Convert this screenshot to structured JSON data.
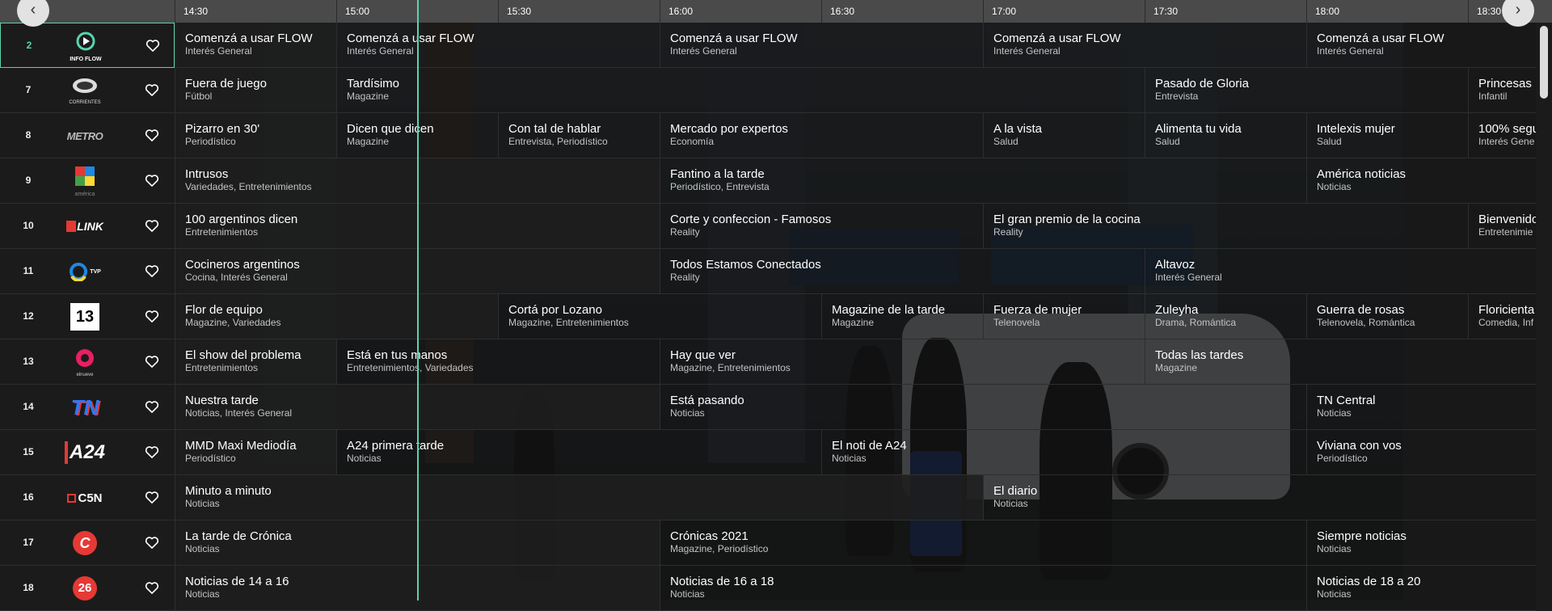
{
  "header": {
    "times": [
      "14:30",
      "15:00",
      "15:30",
      "16:00",
      "16:30",
      "17:00",
      "17:30",
      "18:00",
      "18:30"
    ],
    "prev_label": "‹",
    "next_label": "›"
  },
  "channels": [
    {
      "number": "2",
      "logo": "infoflow",
      "logo_text": "INFO FLOW"
    },
    {
      "number": "7",
      "logo": "corrientes",
      "logo_text": "CORRIENTES"
    },
    {
      "number": "8",
      "logo": "metro",
      "logo_text": "METRO"
    },
    {
      "number": "9",
      "logo": "america",
      "logo_text": "américa"
    },
    {
      "number": "10",
      "logo": "link",
      "logo_text": "LINK"
    },
    {
      "number": "11",
      "logo": "tvp",
      "logo_text": "TVP"
    },
    {
      "number": "12",
      "logo": "eltrece",
      "logo_text": "13"
    },
    {
      "number": "13",
      "logo": "elnueve",
      "logo_text": "elnueve"
    },
    {
      "number": "14",
      "logo": "tn",
      "logo_text": "TN"
    },
    {
      "number": "15",
      "logo": "a24",
      "logo_text": "A24"
    },
    {
      "number": "16",
      "logo": "c5n",
      "logo_text": "C5N"
    },
    {
      "number": "17",
      "logo": "cronica",
      "logo_text": "C"
    },
    {
      "number": "18",
      "logo": "canal26",
      "logo_text": "26"
    }
  ],
  "rows": [
    [
      {
        "s": 0,
        "e": 1,
        "t": "Comenzá a usar FLOW",
        "g": "Interés General"
      },
      {
        "s": 1,
        "e": 3,
        "t": "Comenzá a usar FLOW",
        "g": "Interés General"
      },
      {
        "s": 3,
        "e": 5,
        "t": "Comenzá a usar FLOW",
        "g": "Interés General"
      },
      {
        "s": 5,
        "e": 7,
        "t": "Comenzá a usar FLOW",
        "g": "Interés General"
      },
      {
        "s": 7,
        "e": 9.5,
        "t": "Comenzá a usar FLOW",
        "g": "Interés General"
      }
    ],
    [
      {
        "s": 0,
        "e": 1,
        "t": "Fuera de juego",
        "g": "Fútbol"
      },
      {
        "s": 1,
        "e": 6,
        "t": "Tardísimo",
        "g": "Magazine"
      },
      {
        "s": 6,
        "e": 8,
        "t": "Pasado de Gloria",
        "g": "Entrevista"
      },
      {
        "s": 8,
        "e": 9.5,
        "t": "Princesas",
        "g": "Infantil"
      }
    ],
    [
      {
        "s": 0,
        "e": 1,
        "t": "Pizarro en 30'",
        "g": "Periodístico"
      },
      {
        "s": 1,
        "e": 2,
        "t": "Dicen que dicen",
        "g": "Magazine"
      },
      {
        "s": 2,
        "e": 3,
        "t": "Con tal de hablar",
        "g": "Entrevista, Periodístico"
      },
      {
        "s": 3,
        "e": 5,
        "t": "Mercado por expertos",
        "g": "Economía"
      },
      {
        "s": 5,
        "e": 6,
        "t": "A la vista",
        "g": "Salud"
      },
      {
        "s": 6,
        "e": 7,
        "t": "Alimenta tu vida",
        "g": "Salud"
      },
      {
        "s": 7,
        "e": 8,
        "t": "Intelexis mujer",
        "g": "Salud"
      },
      {
        "s": 8,
        "e": 9.5,
        "t": "100% segu",
        "g": "Interés Gene"
      }
    ],
    [
      {
        "s": 0,
        "e": 3,
        "t": "Intrusos",
        "g": "Variedades, Entretenimientos"
      },
      {
        "s": 3,
        "e": 7,
        "t": "Fantino a la tarde",
        "g": "Periodístico, Entrevista"
      },
      {
        "s": 7,
        "e": 9.5,
        "t": "América noticias",
        "g": "Noticias"
      }
    ],
    [
      {
        "s": 0,
        "e": 3,
        "t": "100 argentinos dicen",
        "g": "Entretenimientos"
      },
      {
        "s": 3,
        "e": 5,
        "t": "Corte y confeccion - Famosos",
        "g": "Reality"
      },
      {
        "s": 5,
        "e": 8,
        "t": "El gran premio de la cocina",
        "g": "Reality"
      },
      {
        "s": 8,
        "e": 9.5,
        "t": "Bienvenido",
        "g": "Entretenimie"
      }
    ],
    [
      {
        "s": 0,
        "e": 3,
        "t": "Cocineros argentinos",
        "g": "Cocina, Interés General"
      },
      {
        "s": 3,
        "e": 6,
        "t": "Todos Estamos Conectados",
        "g": "Reality"
      },
      {
        "s": 6,
        "e": 9.5,
        "t": "Altavoz",
        "g": "Interés General"
      }
    ],
    [
      {
        "s": 0,
        "e": 2,
        "t": "Flor de equipo",
        "g": "Magazine, Variedades"
      },
      {
        "s": 2,
        "e": 4,
        "t": "Cortá por Lozano",
        "g": "Magazine, Entretenimientos"
      },
      {
        "s": 4,
        "e": 5,
        "t": "Magazine de la tarde",
        "g": "Magazine"
      },
      {
        "s": 5,
        "e": 6,
        "t": "Fuerza de mujer",
        "g": "Telenovela"
      },
      {
        "s": 6,
        "e": 7,
        "t": "Zuleyha",
        "g": "Drama, Romántica"
      },
      {
        "s": 7,
        "e": 8,
        "t": "Guerra de rosas",
        "g": "Telenovela, Romántica"
      },
      {
        "s": 8,
        "e": 9.5,
        "t": "Floricienta",
        "g": "Comedia, Inf"
      }
    ],
    [
      {
        "s": 0,
        "e": 1,
        "t": "El show del problema",
        "g": "Entretenimientos"
      },
      {
        "s": 1,
        "e": 3,
        "t": "Está en tus manos",
        "g": "Entretenimientos, Variedades"
      },
      {
        "s": 3,
        "e": 6,
        "t": "Hay que ver",
        "g": "Magazine, Entretenimientos"
      },
      {
        "s": 6,
        "e": 9.5,
        "t": "Todas las tardes",
        "g": "Magazine"
      }
    ],
    [
      {
        "s": 0,
        "e": 3,
        "t": "Nuestra tarde",
        "g": "Noticias, Interés General"
      },
      {
        "s": 3,
        "e": 7,
        "t": "Está pasando",
        "g": "Noticias"
      },
      {
        "s": 7,
        "e": 9.5,
        "t": "TN Central",
        "g": "Noticias"
      }
    ],
    [
      {
        "s": 0,
        "e": 1,
        "t": "MMD Maxi Mediodía",
        "g": "Periodístico"
      },
      {
        "s": 1,
        "e": 4,
        "t": "A24 primera tarde",
        "g": "Noticias"
      },
      {
        "s": 4,
        "e": 7,
        "t": "El noti de A24",
        "g": "Noticias"
      },
      {
        "s": 7,
        "e": 9.5,
        "t": "Viviana con vos",
        "g": "Periodístico"
      }
    ],
    [
      {
        "s": 0,
        "e": 5,
        "t": "Minuto a minuto",
        "g": "Noticias"
      },
      {
        "s": 5,
        "e": 9.5,
        "t": "El diario",
        "g": "Noticias"
      }
    ],
    [
      {
        "s": 0,
        "e": 3,
        "t": "La tarde de Crónica",
        "g": "Noticias"
      },
      {
        "s": 3,
        "e": 7,
        "t": "Crónicas 2021",
        "g": "Magazine, Periodístico"
      },
      {
        "s": 7,
        "e": 9.5,
        "t": "Siempre noticias",
        "g": "Noticias"
      }
    ],
    [
      {
        "s": 0,
        "e": 3,
        "t": "Noticias de 14 a 16",
        "g": "Noticias"
      },
      {
        "s": 3,
        "e": 7,
        "t": "Noticias de 16 a 18",
        "g": "Noticias"
      },
      {
        "s": 7,
        "e": 9.5,
        "t": "Noticias de 18 a 20",
        "g": "Noticias"
      }
    ]
  ],
  "selected_channel": 0,
  "now_time": "15:05",
  "colors": {
    "accent": "#59d4b0",
    "header": "#4a4a4a",
    "background": "#1b1b1b"
  }
}
